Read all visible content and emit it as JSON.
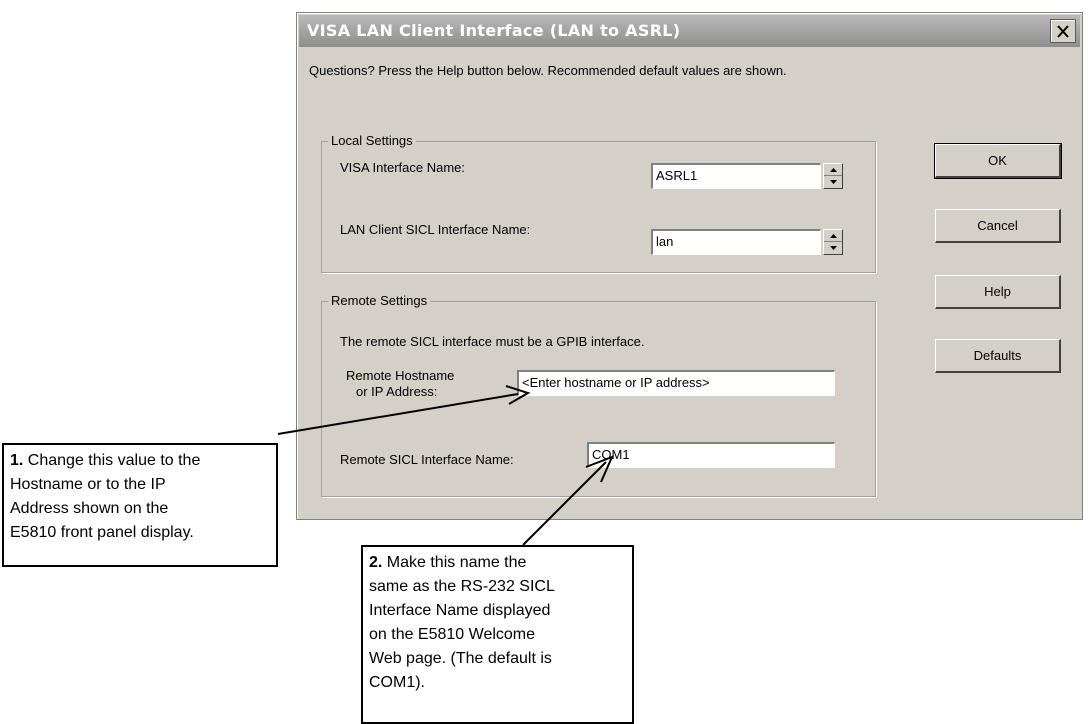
{
  "window": {
    "title": "VISA LAN Client Interface (LAN to ASRL)",
    "instructions": "Questions?  Press the Help button below.  Recommended default values are shown."
  },
  "local_settings": {
    "legend": "Local Settings",
    "visa_label": "VISA Interface Name:",
    "visa_value": "ASRL1",
    "lan_label": "LAN Client SICL Interface Name:",
    "lan_value": "lan"
  },
  "remote_settings": {
    "legend": "Remote Settings",
    "note": "The remote SICL interface must be a GPIB interface.",
    "hostname_label_line1": "Remote Hostname",
    "hostname_label_line2": "or IP Address:",
    "hostname_value": "<Enter hostname or IP address>",
    "sicl_label": "Remote SICL Interface Name:",
    "sicl_value": "COM1"
  },
  "buttons": {
    "ok": "OK",
    "cancel": "Cancel",
    "help": "Help",
    "defaults": "Defaults"
  },
  "callouts": {
    "one": {
      "number": "1.",
      "line1": " Change this value to the",
      "line2": "Hostname or to the IP",
      "line3": "Address shown on the",
      "line4": "E5810 front panel display."
    },
    "two": {
      "number": "2.",
      "line1": " Make this name the",
      "line2": "same as the RS-232 SICL",
      "line3": "Interface Name displayed",
      "line4": "on the E5810 Welcome",
      "line5": "Web page. (The default is",
      "line6": "COM1)."
    }
  }
}
